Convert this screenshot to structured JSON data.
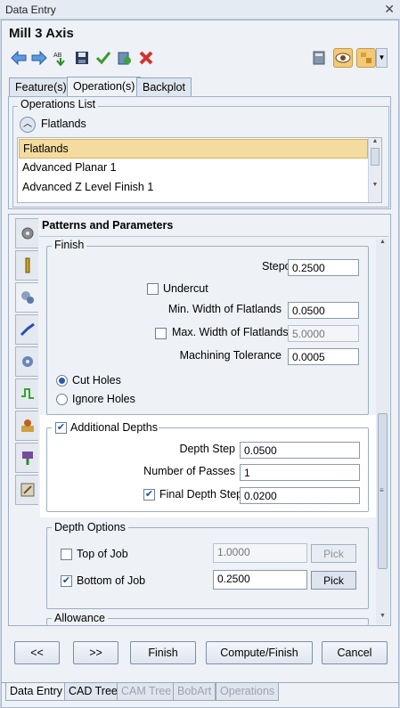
{
  "window": {
    "title": "Data Entry",
    "close_icon": "close-icon"
  },
  "header": {
    "title": "Mill 3 Axis"
  },
  "toolbar": {
    "icons": [
      "arrow-left-icon",
      "arrow-right-icon",
      "sort-down-icon",
      "save-icon",
      "checkmark-icon",
      "export-icon",
      "delete-icon",
      "calculator-icon",
      "eye-icon",
      "settings-menu-icon"
    ]
  },
  "tabs": [
    "Feature(s)",
    "Operation(s)",
    "Backplot"
  ],
  "operations": {
    "legend": "Operations List",
    "current": "Flatlands",
    "items": [
      "Flatlands",
      "Advanced Planar 1",
      "Advanced Z Level Finish 1"
    ]
  },
  "params": {
    "header": "Patterns and Parameters",
    "finish": {
      "legend": "Finish",
      "stepover_label": "Stepover",
      "stepover_value": "0.2500",
      "undercut_label": "Undercut",
      "min_width_label": "Min. Width of Flatlands",
      "min_width_value": "0.0500",
      "max_width_label": "Max. Width of Flatlands",
      "max_width_value": "5.0000",
      "tolerance_label": "Machining Tolerance",
      "tolerance_value": "0.0005",
      "cut_holes_label": "Cut Holes",
      "ignore_holes_label": "Ignore Holes"
    },
    "additional": {
      "label": "Additional Depths",
      "depth_step_label": "Depth Step",
      "depth_step_value": "0.0500",
      "passes_label": "Number of Passes",
      "passes_value": "1",
      "final_step_label": "Final Depth Step",
      "final_step_value": "0.0200"
    },
    "depth_options": {
      "legend": "Depth Options",
      "top_label": "Top of Job",
      "top_value": "1.0000",
      "bottom_label": "Bottom of Job",
      "bottom_value": "0.2500",
      "pick_label": "Pick"
    },
    "allowance": {
      "legend": "Allowance"
    }
  },
  "buttons": {
    "prev": "<<",
    "next": ">>",
    "finish": "Finish",
    "compute": "Compute/Finish",
    "cancel": "Cancel"
  },
  "bottom_tabs": [
    "Data Entry",
    "CAD Tree",
    "CAM Tree",
    "BobArt",
    "Operations"
  ]
}
